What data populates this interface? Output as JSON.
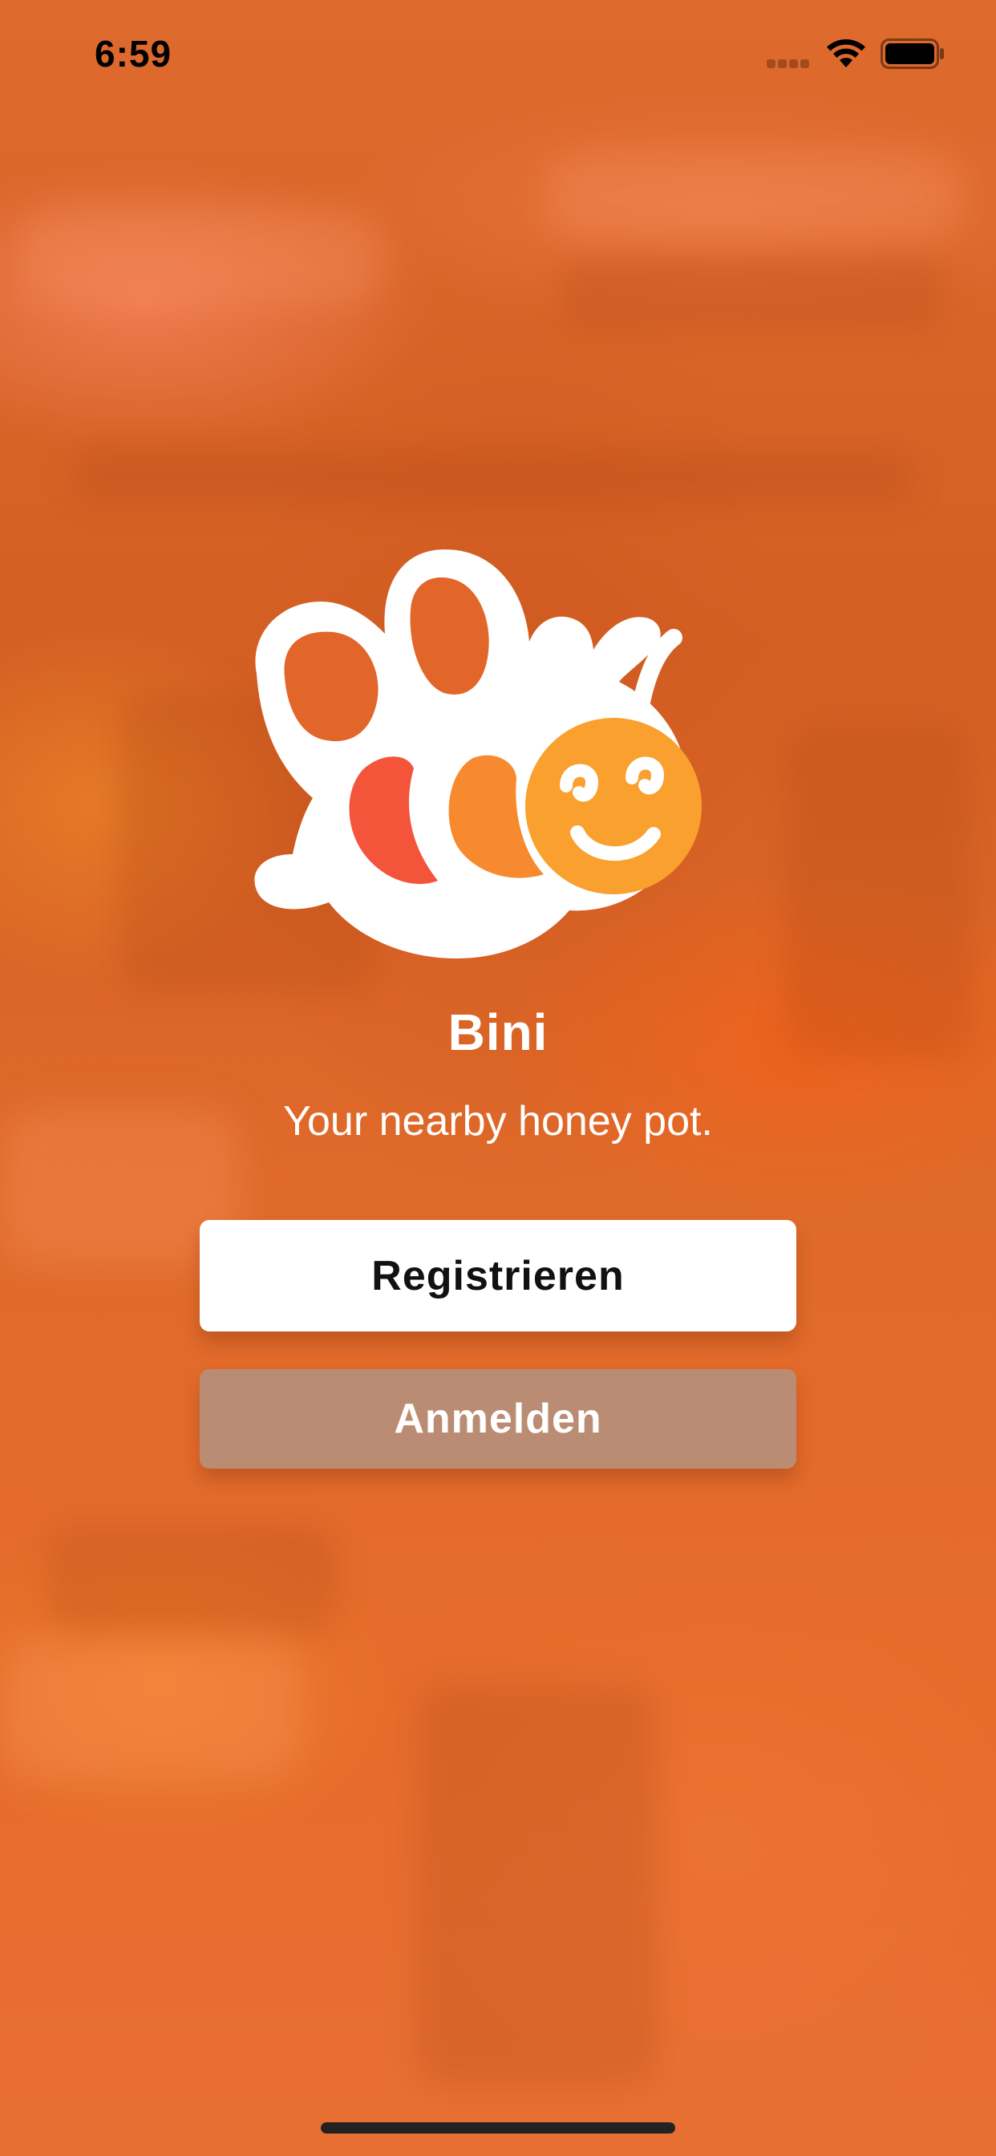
{
  "status_bar": {
    "time": "6:59",
    "icons": [
      "signal-icon",
      "wifi-icon",
      "battery-icon"
    ]
  },
  "app": {
    "logo_icon": "bee-logo-icon",
    "title": "Bini",
    "tagline": "Your nearby honey pot."
  },
  "actions": {
    "register_label": "Registrieren",
    "login_label": "Anmelden"
  },
  "colors": {
    "background": "#e46a2a",
    "register_button": "#ffffff",
    "login_button": "#ba8c73",
    "bee_stripe_red": "#f4553a",
    "bee_stripe_orange": "#f7892f",
    "bee_face": "#f9a02e"
  }
}
